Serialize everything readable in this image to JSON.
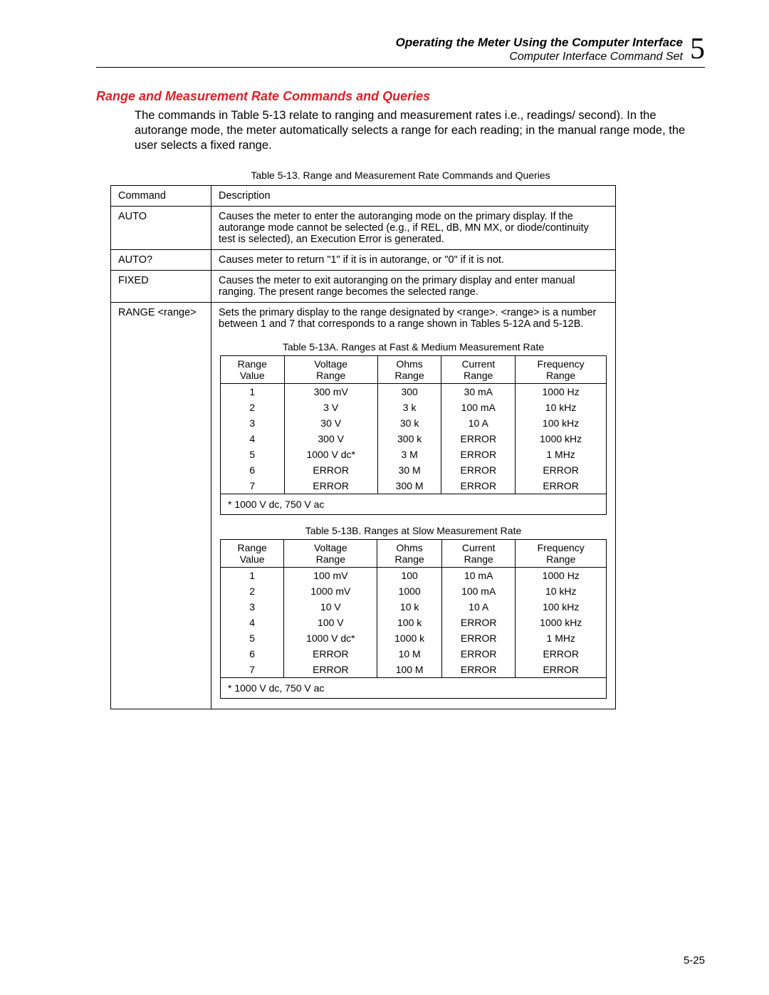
{
  "header": {
    "chapter_title": "Operating the Meter Using the Computer Interface",
    "section_title": "Computer Interface Command Set",
    "chapter_number": "5"
  },
  "section_heading": "Range and Measurement Rate Commands and Queries",
  "intro_text": "The commands in Table 5-13 relate to ranging and measurement rates i.e., readings/ second). In the autorange mode, the meter automatically selects a range for each reading; in the manual range mode, the user selects a fixed range.",
  "main_table": {
    "caption": "Table 5-13. Range and Measurement Rate Commands and Queries",
    "header": {
      "c1": "Command",
      "c2": "Description"
    },
    "rows": [
      {
        "cmd": "AUTO",
        "desc": "Causes the meter to enter the autoranging mode on the primary display. If the autorange mode cannot be selected (e.g., if REL, dB, MN MX, or diode/continuity test is selected), an Execution Error is generated."
      },
      {
        "cmd": "AUTO?",
        "desc": "Causes meter to return \"1\" if it is in autorange, or \"0\" if it is not."
      },
      {
        "cmd": "FIXED",
        "desc": "Causes the meter to exit autoranging on the primary display and enter manual ranging. The present range becomes the selected range."
      },
      {
        "cmd": "RANGE <range>",
        "desc": "Sets the primary display to the range designated by <range>. <range> is a number between 1 and 7 that corresponds to a range shown in Tables 5-12A and 5-12B."
      }
    ]
  },
  "sub_table_A": {
    "caption": "Table 5-13A. Ranges at Fast & Medium Measurement Rate",
    "cols": [
      {
        "l1": "Range",
        "l2": "Value"
      },
      {
        "l1": "Voltage",
        "l2": "Range"
      },
      {
        "l1": "Ohms",
        "l2": "Range"
      },
      {
        "l1": "Current",
        "l2": "Range"
      },
      {
        "l1": "Frequency",
        "l2": "Range"
      }
    ],
    "rows": [
      [
        "1",
        "300 mV",
        "300",
        "30 mA",
        "1000 Hz"
      ],
      [
        "2",
        "3 V",
        "3 k",
        "100 mA",
        "10 kHz"
      ],
      [
        "3",
        "30 V",
        "30 k",
        "10 A",
        "100 kHz"
      ],
      [
        "4",
        "300 V",
        "300 k",
        "ERROR",
        "1000 kHz"
      ],
      [
        "5",
        "1000 V dc*",
        "3 M",
        "ERROR",
        "1 MHz"
      ],
      [
        "6",
        "ERROR",
        "30 M",
        "ERROR",
        "ERROR"
      ],
      [
        "7",
        "ERROR",
        "300 M",
        "ERROR",
        "ERROR"
      ]
    ],
    "footnote": "* 1000 V dc, 750 V ac"
  },
  "sub_table_B": {
    "caption": "Table 5-13B. Ranges at Slow Measurement Rate",
    "cols": [
      {
        "l1": "Range",
        "l2": "Value"
      },
      {
        "l1": "Voltage",
        "l2": "Range"
      },
      {
        "l1": "Ohms",
        "l2": "Range"
      },
      {
        "l1": "Current",
        "l2": "Range"
      },
      {
        "l1": "Frequency",
        "l2": "Range"
      }
    ],
    "rows": [
      [
        "1",
        "100 mV",
        "100",
        "10 mA",
        "1000 Hz"
      ],
      [
        "2",
        "1000 mV",
        "1000",
        "100 mA",
        "10 kHz"
      ],
      [
        "3",
        "10 V",
        "10 k",
        "10 A",
        "100 kHz"
      ],
      [
        "4",
        "100 V",
        "100 k",
        "ERROR",
        "1000 kHz"
      ],
      [
        "5",
        "1000 V dc*",
        "1000 k",
        "ERROR",
        "1 MHz"
      ],
      [
        "6",
        "ERROR",
        "10 M",
        "ERROR",
        "ERROR"
      ],
      [
        "7",
        "ERROR",
        "100 M",
        "ERROR",
        "ERROR"
      ]
    ],
    "footnote": "* 1000 V dc, 750 V ac"
  },
  "page_number": "5-25"
}
